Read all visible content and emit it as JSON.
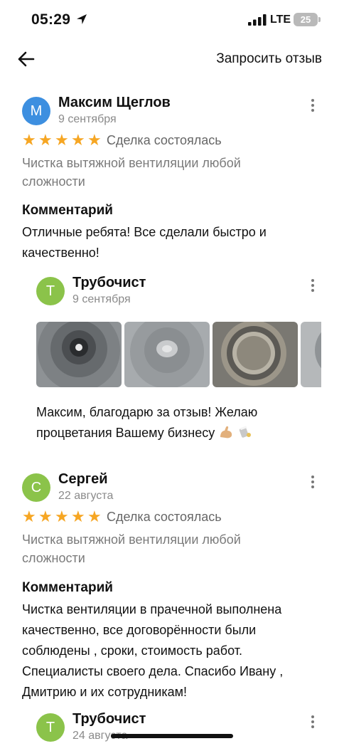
{
  "status_bar": {
    "time": "05:29",
    "network": "LTE",
    "battery": "25"
  },
  "nav": {
    "request_review_label": "Запросить отзыв"
  },
  "reviews": [
    {
      "initial": "М",
      "avatar_color": "#3d8fe0",
      "author": "Максим Щеглов",
      "date": "9 сентября",
      "rating": 5,
      "status": "Сделка состоялась",
      "service": "Чистка вытяжной вентиляции любой сложности",
      "comment_title": "Комментарий",
      "comment": "Отличные ребята! Все сделали быстро и качественно!",
      "reply": {
        "initial": "Т",
        "avatar_color": "#8bc34a",
        "author": "Трубочист",
        "date": "9 сентября",
        "text": "Максим, благодарю за отзыв! Желаю процветания Вашему бизнесу",
        "emoji": [
          "flexed-biceps",
          "beer-mug-clink"
        ]
      }
    },
    {
      "initial": "С",
      "avatar_color": "#8bc34a",
      "author": "Сергей",
      "date": "22 августа",
      "rating": 5,
      "status": "Сделка состоялась",
      "service": "Чистка вытяжной вентиляции любой сложности",
      "comment_title": "Комментарий",
      "comment": "Чистка вентиляции в прачечной выполнена качественно, все договорённости были соблюдены , сроки, стоимость работ. Специалисты своего дела. Спасибо Ивану , Дмитрию и их  сотрудникам!",
      "reply": {
        "initial": "Т",
        "avatar_color": "#8bc34a",
        "author": "Трубочист",
        "date": "24 августа"
      }
    }
  ],
  "icons": {
    "back": "arrow-left-icon",
    "menu": "more-vertical-icon",
    "star": "star-icon",
    "location": "location-arrow-icon"
  },
  "colors": {
    "star": "#f6a623",
    "muted": "#8a8a8a"
  }
}
